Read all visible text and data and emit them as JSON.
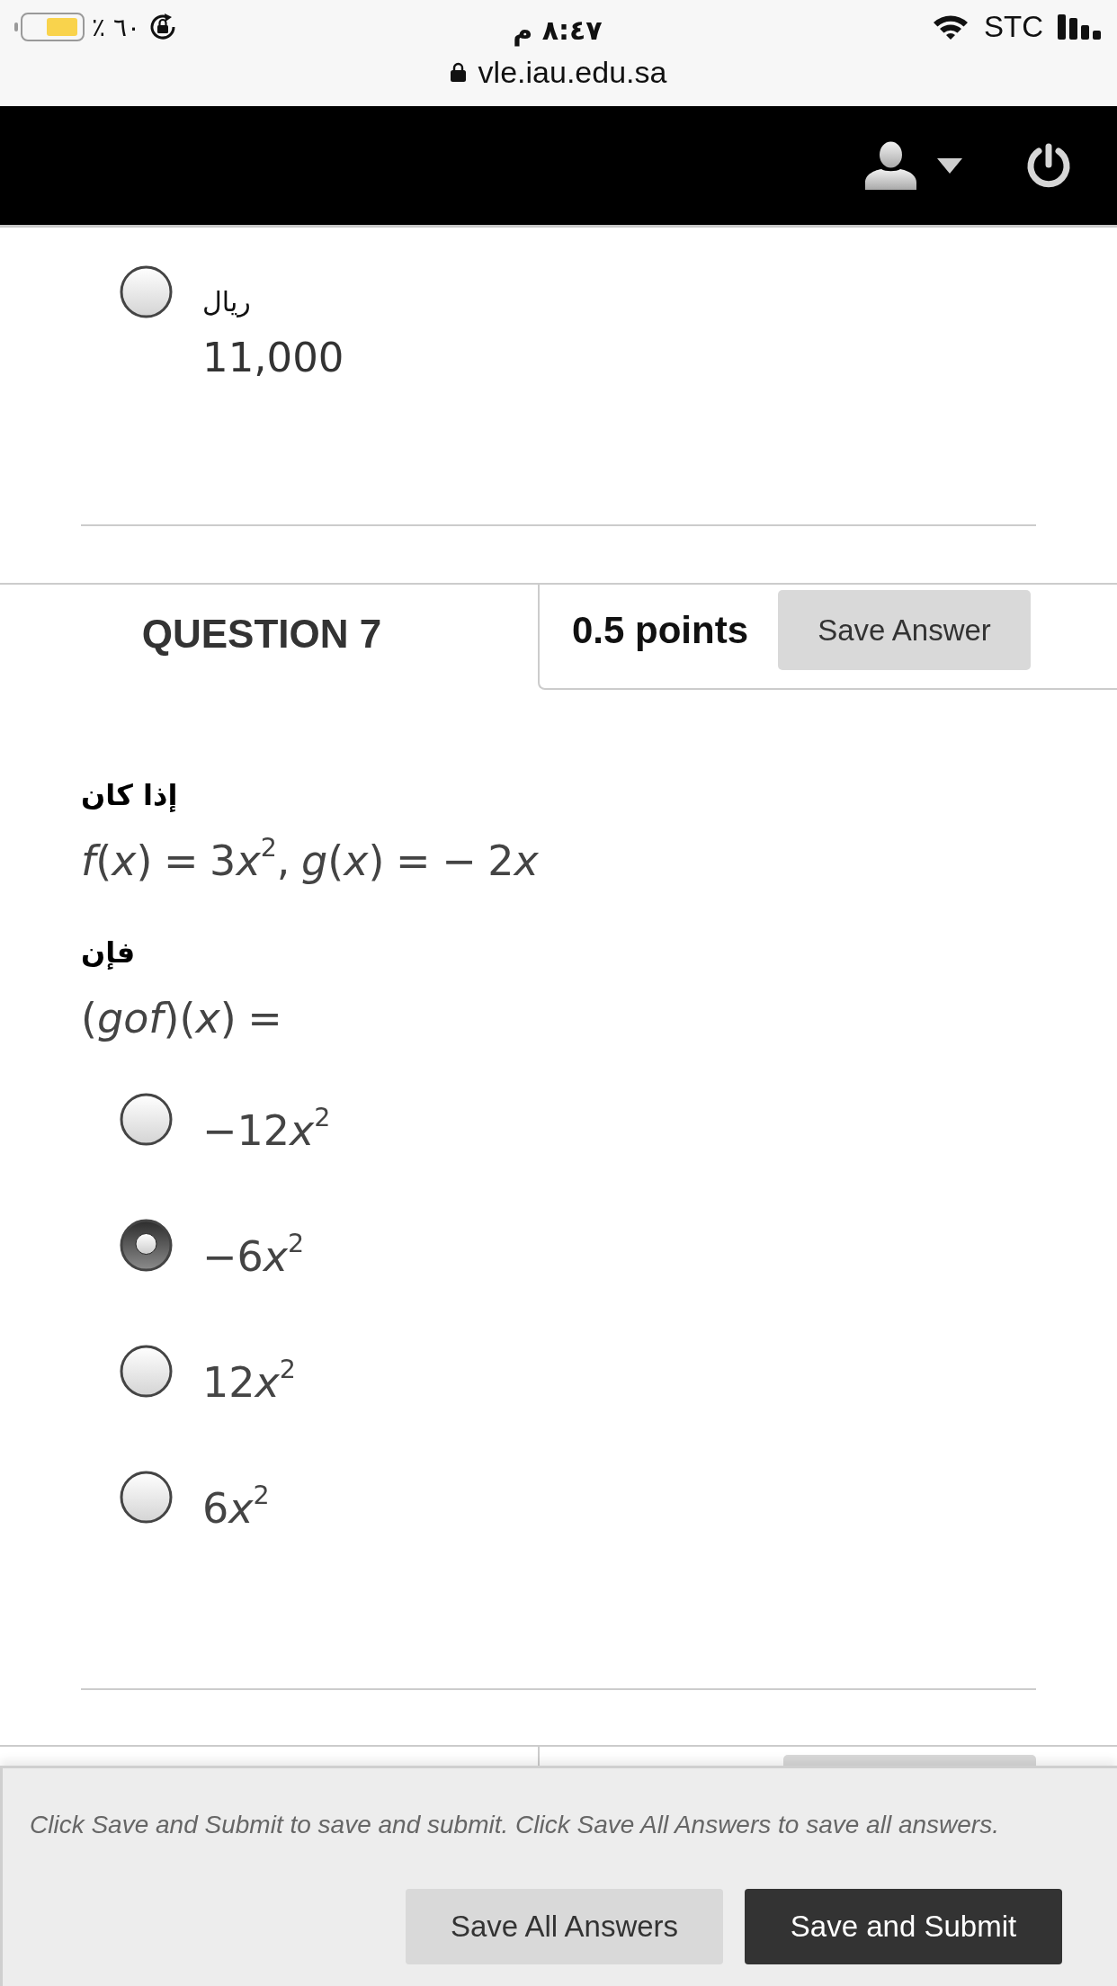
{
  "status_bar": {
    "battery_text": "٪ ٦٠",
    "time": "٨:٤٧ م",
    "carrier": "STC",
    "url": "vle.iau.edu.sa"
  },
  "previous_question": {
    "options": [
      {
        "lines": [
          "ريال",
          "11,000"
        ],
        "selected": false
      }
    ]
  },
  "question": {
    "title": "QUESTION 7",
    "points": "0.5 points",
    "save_button": "Save Answer",
    "prompt": [
      {
        "kind": "label",
        "text": "إذا كان"
      },
      {
        "kind": "math",
        "parts": [
          {
            "kind": "variable",
            "text": "f"
          },
          {
            "kind": "plain",
            "text": "("
          },
          {
            "kind": "variable",
            "text": "x"
          },
          {
            "kind": "plain",
            "text": ") = 3"
          },
          {
            "kind": "variable",
            "text": "x"
          },
          {
            "kind": "plain",
            "text": "$^{2}$, "
          },
          {
            "kind": "variable",
            "text": "g"
          },
          {
            "kind": "plain",
            "text": "("
          },
          {
            "kind": "variable",
            "text": "x"
          },
          {
            "kind": "plain",
            "text": ") = − 2"
          },
          {
            "kind": "variable",
            "text": "x"
          }
        ]
      },
      {
        "kind": "label",
        "text": "فإن"
      },
      {
        "kind": "math",
        "parts": [
          {
            "kind": "plain",
            "text": "("
          },
          {
            "kind": "variable",
            "text": "gof"
          },
          {
            "kind": "plain",
            "text": ")("
          },
          {
            "kind": "variable",
            "text": "x"
          },
          {
            "kind": "plain",
            "text": ") ="
          }
        ]
      }
    ],
    "options": [
      {
        "parts": [
          {
            "kind": "plain",
            "text": "−12"
          },
          {
            "kind": "variable",
            "text": "x"
          },
          {
            "kind": "plain",
            "text": "$^{2}$"
          }
        ],
        "selected": false
      },
      {
        "parts": [
          {
            "kind": "plain",
            "text": "−6"
          },
          {
            "kind": "variable",
            "text": "x"
          },
          {
            "kind": "plain",
            "text": "$^{2}$"
          }
        ],
        "selected": true
      },
      {
        "parts": [
          {
            "kind": "plain",
            "text": "12"
          },
          {
            "kind": "variable",
            "text": "x"
          },
          {
            "kind": "plain",
            "text": "$^{2}$"
          }
        ],
        "selected": false
      },
      {
        "parts": [
          {
            "kind": "plain",
            "text": "6"
          },
          {
            "kind": "variable",
            "text": "x"
          },
          {
            "kind": "plain",
            "text": "$^{2}$"
          }
        ],
        "selected": false
      }
    ]
  },
  "footer": {
    "instructions": "Click Save and Submit to save and submit. Click Save All Answers to save all answers.",
    "buttons": [
      {
        "label": "Save All Answers",
        "kind": "secondary"
      },
      {
        "label": "Save and Submit",
        "kind": "primary"
      }
    ]
  }
}
